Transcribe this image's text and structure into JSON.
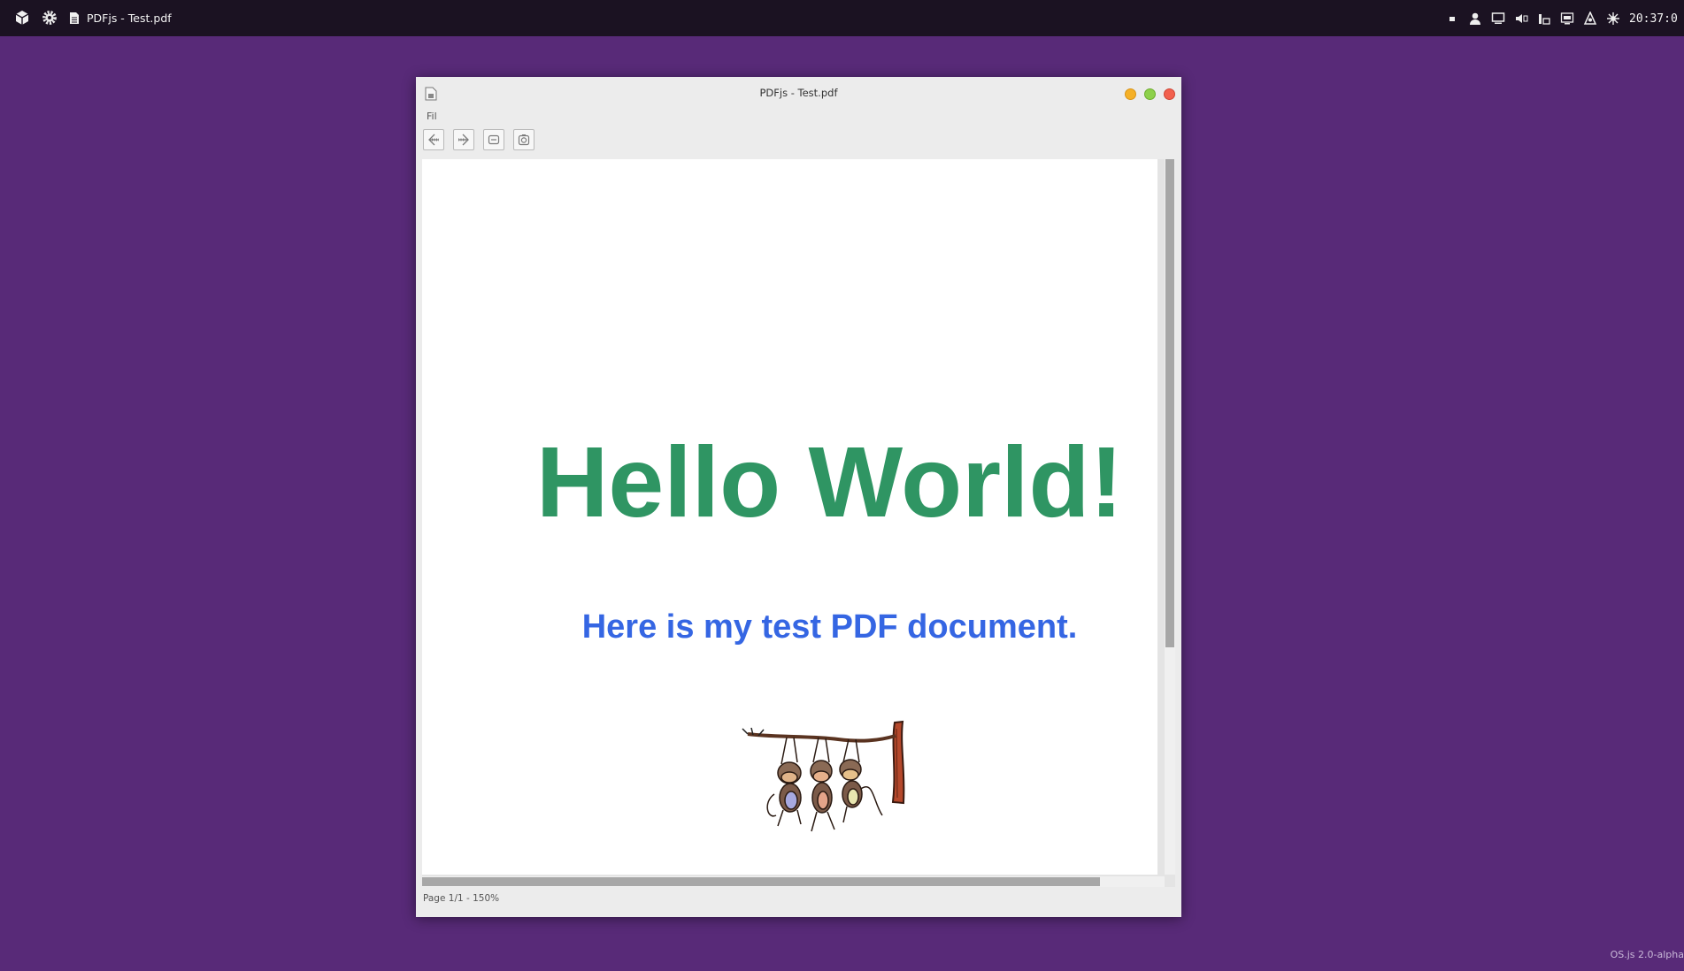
{
  "taskbar": {
    "window_title": "PDFjs - Test.pdf",
    "clock": "20:37:0",
    "tray_icons": [
      "stop-icon",
      "user-icon",
      "monitor-icon",
      "volume-icon",
      "network-icon",
      "display-icon",
      "accessibility-icon",
      "notification-icon"
    ]
  },
  "window": {
    "title": "PDFjs - Test.pdf",
    "menu": [
      "Fil"
    ],
    "toolbar": [
      "back-icon",
      "forward-icon",
      "fit-page-icon",
      "zoom-icon"
    ],
    "status": "Page 1/1 - 150%"
  },
  "document": {
    "heading": "Hello World!",
    "subheading": "Here is my test PDF document.",
    "heading_color": "#2f9563",
    "subheading_color": "#3566e3"
  },
  "desktop": {
    "brand_line": "OS.js 2.0-alpha"
  },
  "colors": {
    "desktop_bg": "#582a78",
    "taskbar_bg": "#1b1222",
    "window_bg": "#ececec"
  }
}
